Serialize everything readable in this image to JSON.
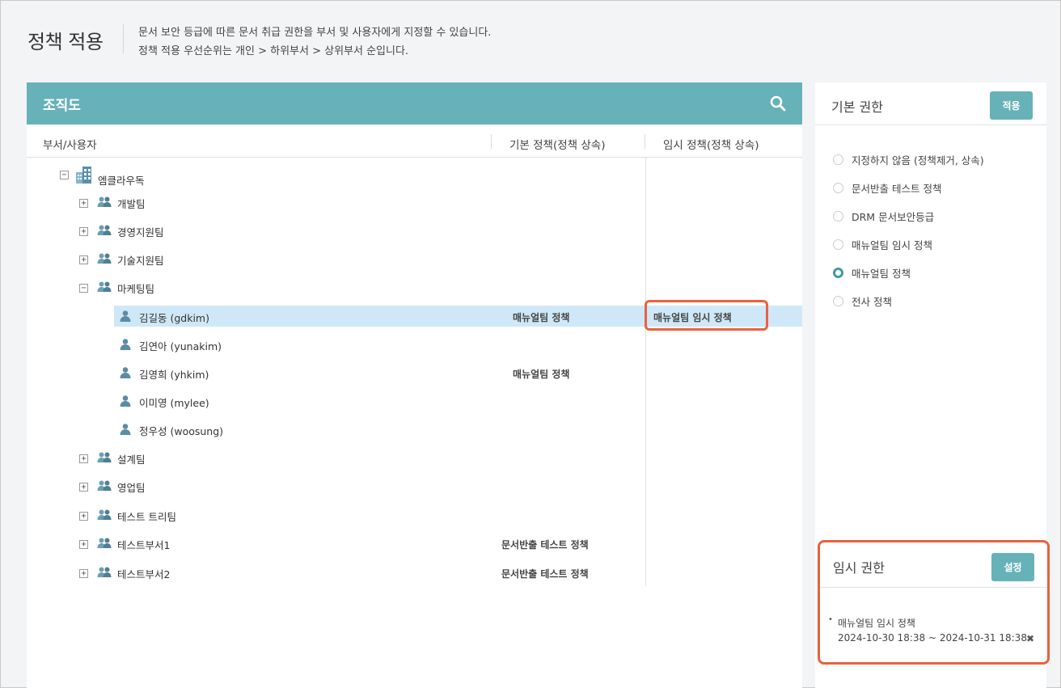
{
  "header": {
    "title": "정책 적용",
    "desc_line1": "문서 보안 등급에 따른 문서 취급 권한을 부서 및 사용자에게 지정할 수 있습니다.",
    "desc_line2": "정책 적용 우선순위는 개인 > 하위부서 > 상위부서 순입니다."
  },
  "org": {
    "title": "조직도",
    "columns": [
      "부서/사용자",
      "기본 정책(정책 상속)",
      "임시 정책(정책 상속)"
    ],
    "root": "엠클라우독",
    "nodes": [
      {
        "label": "개발팀",
        "type": "dept",
        "expander": "⊞",
        "default": "",
        "temp": ""
      },
      {
        "label": "경영지원팀",
        "type": "dept",
        "expander": "⊞",
        "default": "",
        "temp": ""
      },
      {
        "label": "기술지원팀",
        "type": "dept",
        "expander": "⊞",
        "default": "",
        "temp": ""
      },
      {
        "label": "마케팅팀",
        "type": "dept",
        "expander": "⊟",
        "default": "",
        "temp": ""
      },
      {
        "label": "김길동 (gdkim)",
        "type": "user",
        "default": "매뉴얼팀 정책",
        "temp": "매뉴얼팀 임시 정책"
      },
      {
        "label": "김연아 (yunakim)",
        "type": "user",
        "default": "",
        "temp": ""
      },
      {
        "label": "김영희 (yhkim)",
        "type": "user",
        "default": "매뉴얼팀 정책",
        "temp": ""
      },
      {
        "label": "이미영 (mylee)",
        "type": "user",
        "default": "",
        "temp": ""
      },
      {
        "label": "정우성 (woosung)",
        "type": "user",
        "default": "",
        "temp": ""
      },
      {
        "label": "설계팀",
        "type": "dept",
        "expander": "⊞",
        "default": "",
        "temp": ""
      },
      {
        "label": "영업팀",
        "type": "dept",
        "expander": "⊞",
        "default": "",
        "temp": ""
      },
      {
        "label": "테스트 트리팀",
        "type": "dept",
        "expander": "⊞",
        "default": "",
        "temp": ""
      },
      {
        "label": "테스트부서1",
        "type": "dept",
        "expander": "⊞",
        "default": "문서반출 테스트 정책",
        "temp": ""
      },
      {
        "label": "테스트부서2",
        "type": "dept",
        "expander": "⊞",
        "default": "문서반출 테스트 정책",
        "temp": ""
      }
    ]
  },
  "basic": {
    "title": "기본 권한",
    "apply_label": "적용",
    "options": [
      {
        "label": "지정하지 않음 (정책제거, 상속)",
        "checked": false
      },
      {
        "label": "문서반출 테스트 정책",
        "checked": false
      },
      {
        "label": "DRM 문서보안등급",
        "checked": false
      },
      {
        "label": "매뉴얼팀 임시 정책",
        "checked": false
      },
      {
        "label": "매뉴얼팀 정책",
        "checked": true
      },
      {
        "label": "전사 정책",
        "checked": false
      }
    ]
  },
  "temp": {
    "title": "임시 권한",
    "set_label": "설정",
    "bullet": "•",
    "name": "매뉴얼팀 임시 정책",
    "period": "2024-10-30 18:38 ~ 2024-10-31 18:38",
    "close": "✖"
  },
  "colors": {
    "accent": "#66b2b8",
    "highlight": "#cfe8f7",
    "callout": "#e8623c"
  }
}
